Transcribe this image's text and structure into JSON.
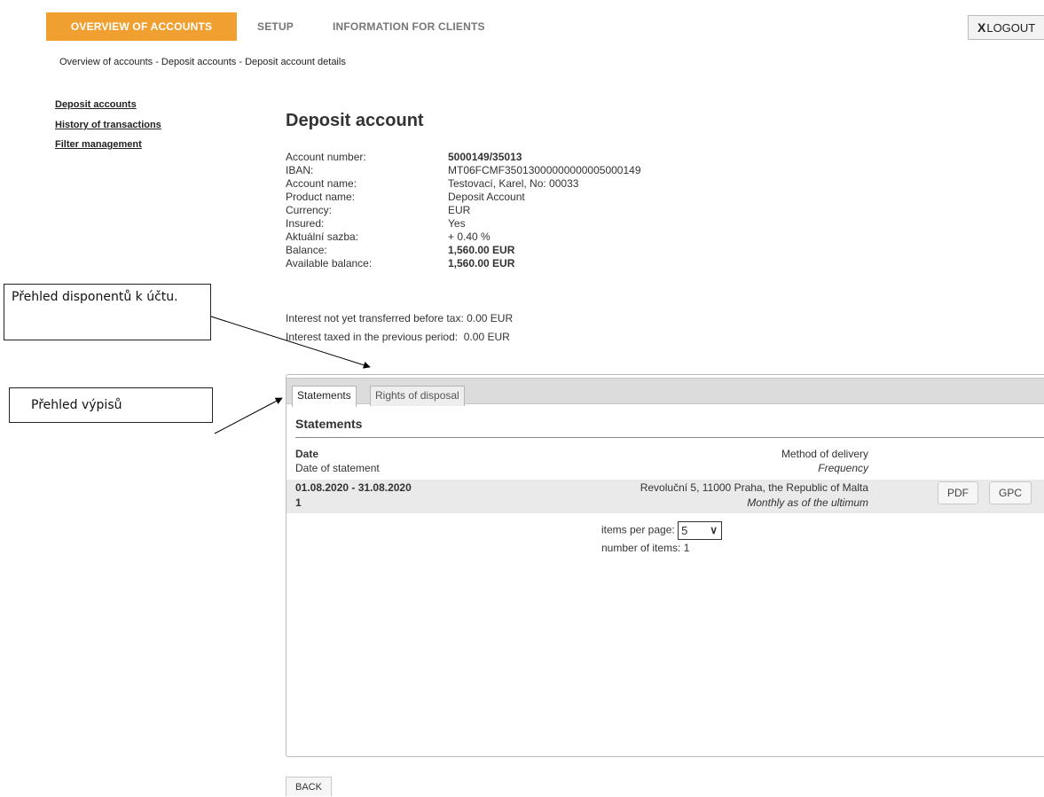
{
  "nav": {
    "overview": "OVERVIEW OF ACCOUNTS",
    "setup": "SETUP",
    "info": "INFORMATION FOR CLIENTS",
    "logout_x": "X",
    "logout": "LOGOUT"
  },
  "breadcrumb": "Overview of accounts - Deposit accounts - Deposit account details",
  "sidebar": {
    "items": [
      "Deposit accounts",
      "History of transactions",
      "Filter management"
    ]
  },
  "page_title": "Deposit account",
  "details": [
    {
      "label": "Account number:",
      "value": "5000149/35013"
    },
    {
      "label": "IBAN:",
      "value": "MT06FCMF35013000000000005000149"
    },
    {
      "label": "Account name:",
      "value": "Testovací, Karel, No: 00033"
    },
    {
      "label": "Product name:",
      "value": "Deposit Account"
    },
    {
      "label": "Currency:",
      "value": "EUR"
    },
    {
      "label": "Insured:",
      "value": "Yes"
    },
    {
      "label": "Aktuální sazba:",
      "value": "+ 0.40 %"
    },
    {
      "label": "Balance:",
      "value": "1,560.00 EUR"
    },
    {
      "label": "Available balance:",
      "value": "1,560.00 EUR"
    }
  ],
  "interest": {
    "not_transferred": "Interest not yet transferred before tax: 0.00 EUR",
    "taxed_previous": "Interest taxed in the previous period:  0.00 EUR"
  },
  "tabs": [
    "Statements",
    "Rights of disposal"
  ],
  "statements": {
    "title": "Statements",
    "header": {
      "date": "Date",
      "date_of_statement": "Date of statement",
      "method": "Method of delivery",
      "frequency": "Frequency"
    },
    "rows": [
      {
        "period": "01.08.2020 - 31.08.2020",
        "number": "1",
        "address": "Revoluční 5, 11000 Praha, the Republic of Malta",
        "frequency": "Monthly as of the ultimum",
        "pdf": "PDF",
        "gpc": "GPC"
      }
    ],
    "items_per_page_label": "items per page:",
    "items_per_page_value": "5",
    "number_of_items": "number of items: 1"
  },
  "back": "BACK",
  "annotations": {
    "disponents": "Přehled disponentů k účtu.",
    "statements": "Přehled výpisů"
  }
}
